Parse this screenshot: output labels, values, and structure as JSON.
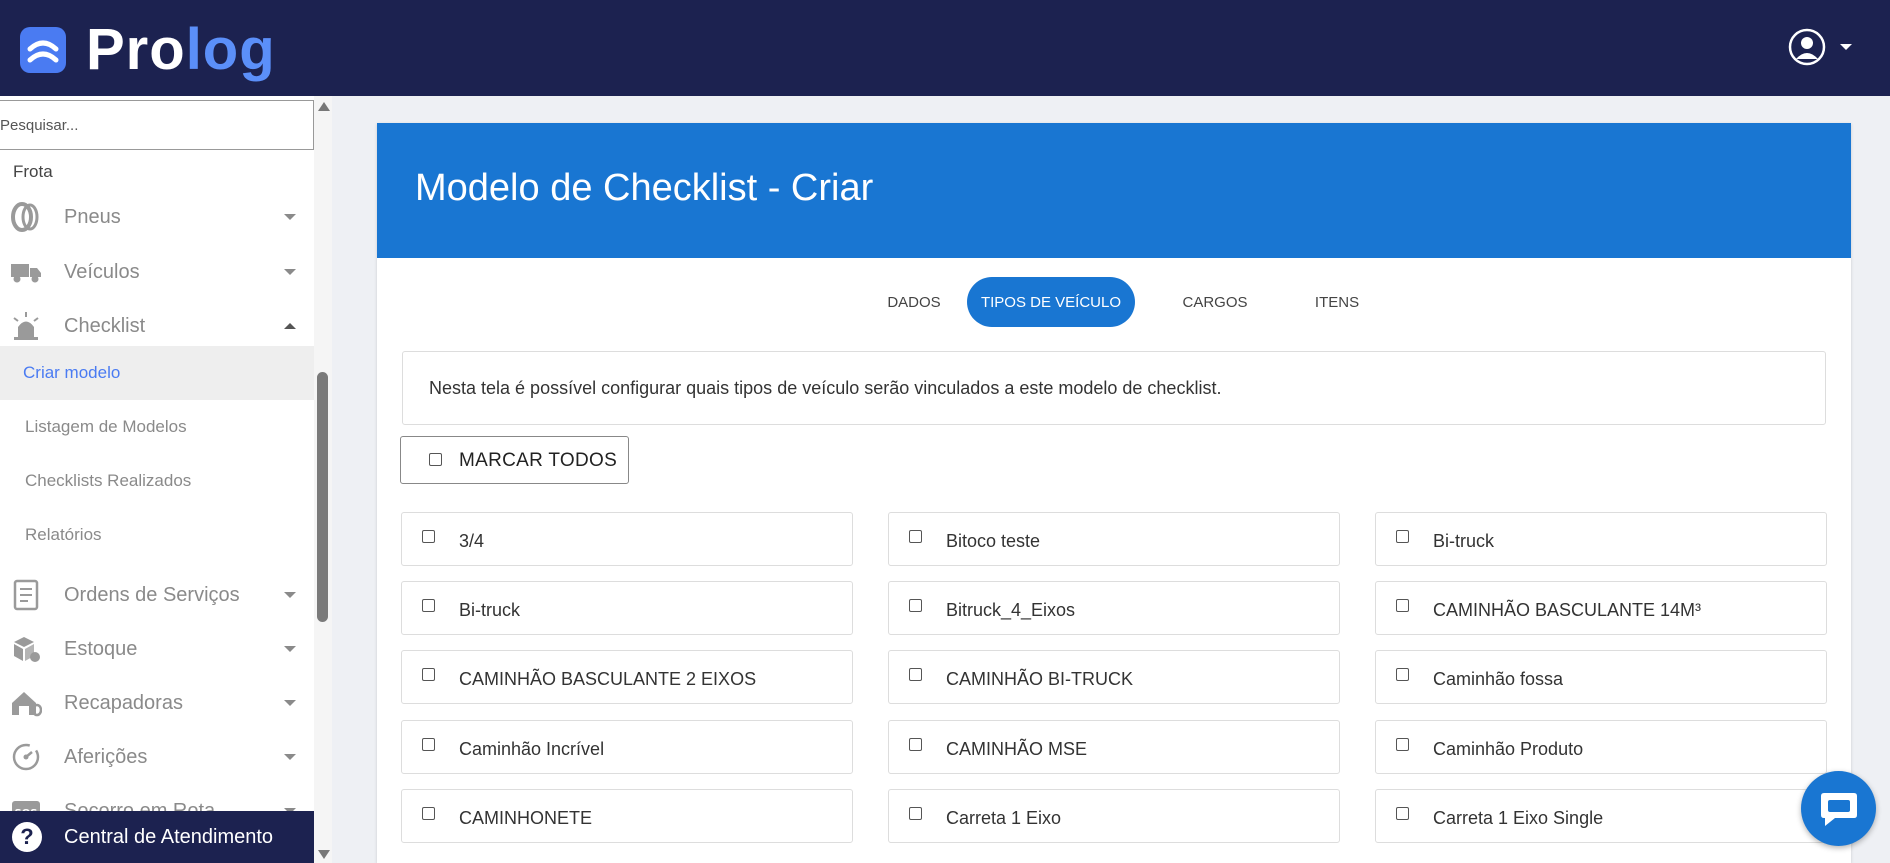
{
  "brand": {
    "name_part1": "Pro",
    "name_part2": "log",
    "accent": "#4a7bf2",
    "header_bg": "#1c2250"
  },
  "sidebar": {
    "search_placeholder": "Pesquisar...",
    "section": "Frota",
    "items": [
      {
        "label": "Pneus",
        "icon": "tire-icon"
      },
      {
        "label": "Veículos",
        "icon": "truck-icon"
      },
      {
        "label": "Checklist",
        "icon": "siren-icon",
        "expanded": true
      },
      {
        "label": "Ordens de Serviços",
        "icon": "document-icon"
      },
      {
        "label": "Estoque",
        "icon": "boxes-icon"
      },
      {
        "label": "Recapadoras",
        "icon": "garage-icon"
      },
      {
        "label": "Aferições",
        "icon": "gauge-icon"
      },
      {
        "label": "Socorro em Rota",
        "icon": "sos-icon"
      }
    ],
    "subitems": [
      "Criar modelo",
      "Listagem de Modelos",
      "Checklists Realizados",
      "Relatórios"
    ],
    "active_subitem": "Criar modelo",
    "help": "Central de Atendimento"
  },
  "page": {
    "title": "Modelo de Checklist - Criar",
    "tabs": [
      "DADOS",
      "TIPOS DE VEÍCULO",
      "CARGOS",
      "ITENS"
    ],
    "active_tab": "TIPOS DE VEÍCULO",
    "info": "Nesta tela é possível configurar quais tipos de veículo serão vinculados a este modelo de checklist.",
    "mark_all": "MARCAR TODOS",
    "vehicle_types": [
      "3/4",
      "Bitoco teste",
      "Bi-truck",
      "Bi-truck",
      "Bitruck_4_Eixos",
      "CAMINHÃO BASCULANTE 14M³",
      "CAMINHÃO BASCULANTE 2 EIXOS",
      "CAMINHÃO BI-TRUCK",
      "Caminhão fossa",
      "Caminhão Incrível",
      "CAMINHÃO MSE",
      "Caminhão Produto",
      "CAMINHONETE",
      "Carreta 1 Eixo",
      "Carreta 1 Eixo Single"
    ],
    "primary_color": "#1976d2"
  }
}
